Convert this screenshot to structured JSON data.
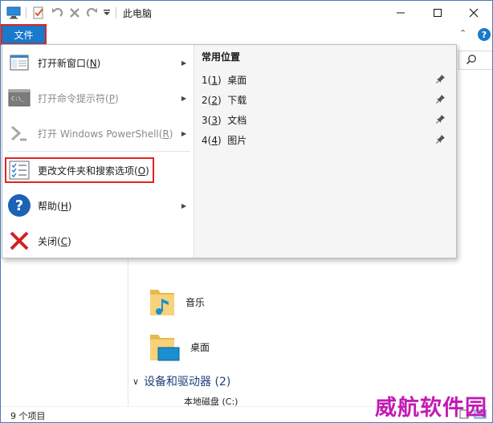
{
  "window": {
    "title": "此电脑",
    "colors": {
      "accent": "#1979ca",
      "outline": "#e02424",
      "watermark": "#c21bb4"
    }
  },
  "quick_access": {
    "icons": [
      "computer-icon",
      "properties-icon",
      "undo-icon",
      "delete-icon",
      "redo-icon",
      "customize-dropdown-icon"
    ]
  },
  "window_controls": {
    "minimize": "minimize-icon",
    "maximize": "maximize-icon",
    "close": "close-icon"
  },
  "ribbon": {
    "file_tab": "文件",
    "help_icon": "?"
  },
  "file_menu": {
    "items": [
      {
        "label": "打开新窗口(",
        "key": "N",
        "end": ")",
        "icon": "new-window-icon",
        "has_arrow": true,
        "disabled": false
      },
      {
        "label": "打开命令提示符(",
        "key": "P",
        "end": ")",
        "icon": "command-prompt-icon",
        "has_arrow": true,
        "disabled": true
      },
      {
        "label": "打开 Windows PowerShell(",
        "key": "R",
        "end": ")",
        "icon": "powershell-icon",
        "has_arrow": true,
        "disabled": true
      },
      {
        "label": "更改文件夹和搜索选项(",
        "key": "O",
        "end": ")",
        "icon": "folder-options-icon",
        "has_arrow": false,
        "disabled": false
      },
      {
        "label": "帮助(",
        "key": "H",
        "end": ")",
        "icon": "help-icon",
        "has_arrow": true,
        "disabled": false
      },
      {
        "label": "关闭(",
        "key": "C",
        "end": ")",
        "icon": "close-x-icon",
        "has_arrow": false,
        "disabled": false
      }
    ],
    "frequent_places": {
      "title": "常用位置",
      "items": [
        {
          "num": "1(",
          "key": "1",
          "end": ")",
          "name": "桌面"
        },
        {
          "num": "2(",
          "key": "2",
          "end": ")",
          "name": "下载"
        },
        {
          "num": "3(",
          "key": "3",
          "end": ")",
          "name": "文档"
        },
        {
          "num": "4(",
          "key": "4",
          "end": ")",
          "name": "图片"
        }
      ]
    }
  },
  "content": {
    "folders": [
      {
        "name": "音乐",
        "icon": "music-folder-icon"
      },
      {
        "name": "桌面",
        "icon": "desktop-folder-icon"
      }
    ],
    "section": {
      "title": "设备和驱动器 (2)"
    },
    "drive": {
      "name": "本地磁盘 (C:)"
    }
  },
  "status": {
    "count": "9 个项目"
  },
  "watermark": "威航软件园"
}
